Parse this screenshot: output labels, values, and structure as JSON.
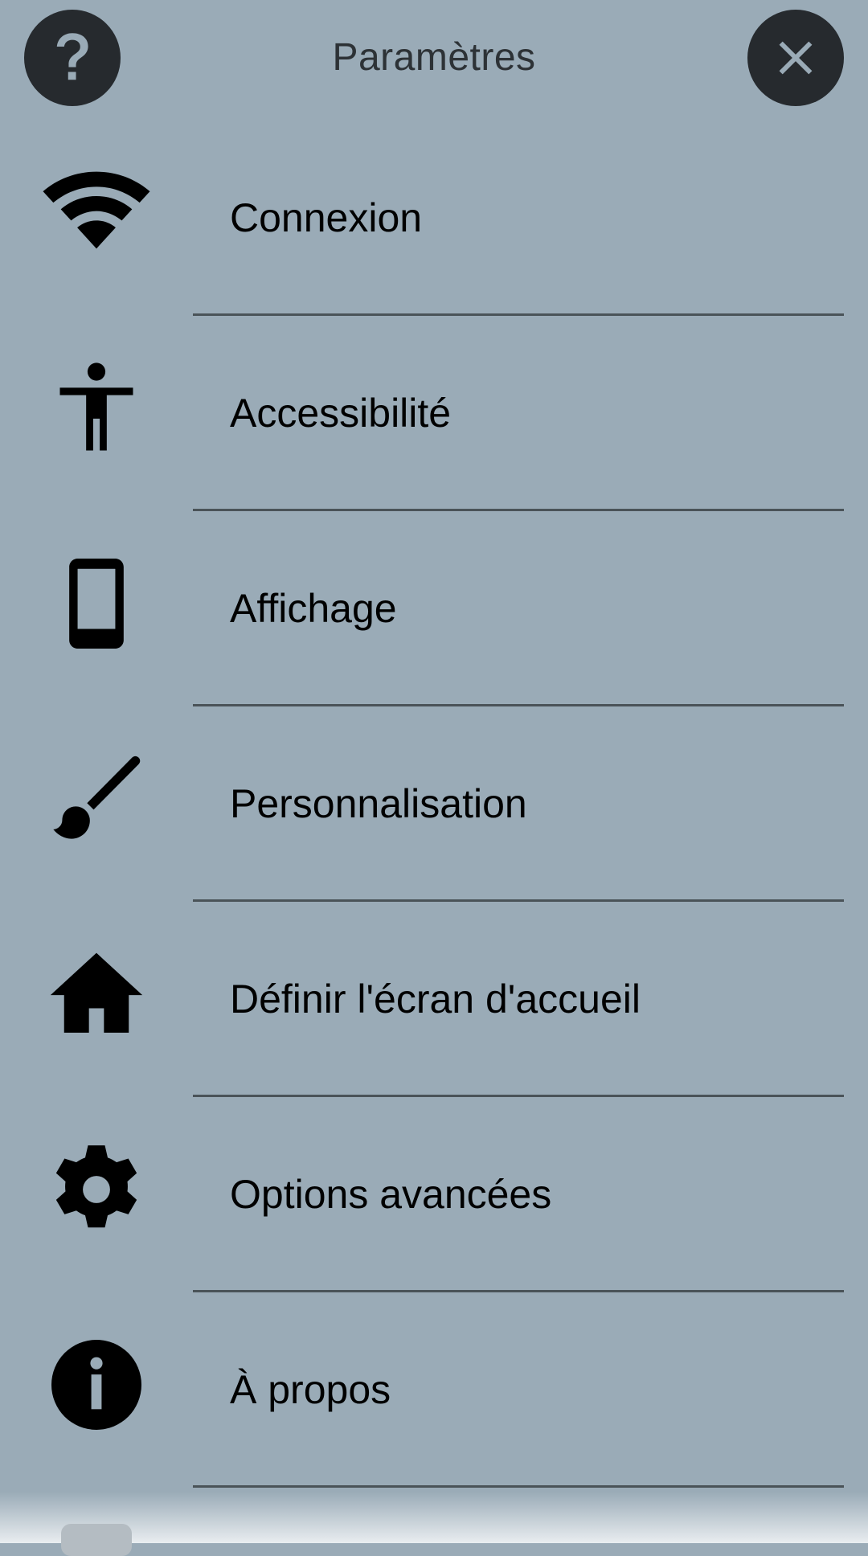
{
  "header": {
    "title": "Paramètres",
    "help_icon": "help-icon",
    "close_icon": "close-icon"
  },
  "menu": {
    "items": [
      {
        "label": "Connexion",
        "icon": "wifi-icon"
      },
      {
        "label": "Accessibilité",
        "icon": "accessibility-icon"
      },
      {
        "label": "Affichage",
        "icon": "smartphone-icon"
      },
      {
        "label": "Personnalisation",
        "icon": "brush-icon"
      },
      {
        "label": "Définir l'écran d'accueil",
        "icon": "home-icon"
      },
      {
        "label": "Options avancées",
        "icon": "gear-icon"
      },
      {
        "label": "À propos",
        "icon": "info-icon"
      }
    ]
  },
  "colors": {
    "background": "#9aabb7",
    "header_button": "#262a2e",
    "header_button_glyph": "#9aabb7",
    "divider": "#4a5358",
    "text": "#000000"
  }
}
